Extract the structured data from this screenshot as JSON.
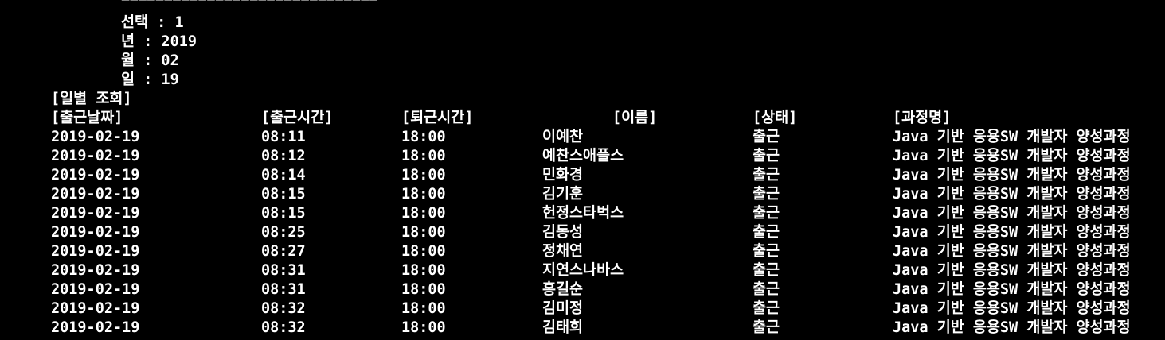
{
  "console": {
    "separator": "==============================",
    "prompts": {
      "select": "선택 : 1",
      "year": "년 : 2019",
      "month": "월 : 02",
      "day": "일 : 19"
    },
    "section_title": "[일별 조회]",
    "headers": {
      "date": "[출근날짜]",
      "check_in": "[출근시간]",
      "check_out": "[퇴근시간]",
      "name": "[이름]",
      "status": "[상태]",
      "course": "[과정명]"
    },
    "rows": [
      {
        "date": "2019-02-19",
        "check_in": "08:11",
        "check_out": "18:00",
        "name": "이예찬",
        "status": "출근",
        "course": "Java 기반 응용SW 개발자 양성과정"
      },
      {
        "date": "2019-02-19",
        "check_in": "08:12",
        "check_out": "18:00",
        "name": "예찬스애플스",
        "status": "출근",
        "course": "Java 기반 응용SW 개발자 양성과정"
      },
      {
        "date": "2019-02-19",
        "check_in": "08:14",
        "check_out": "18:00",
        "name": "민화경",
        "status": "출근",
        "course": "Java 기반 응용SW 개발자 양성과정"
      },
      {
        "date": "2019-02-19",
        "check_in": "08:15",
        "check_out": "18:00",
        "name": "김기훈",
        "status": "출근",
        "course": "Java 기반 응용SW 개발자 양성과정"
      },
      {
        "date": "2019-02-19",
        "check_in": "08:15",
        "check_out": "18:00",
        "name": "헌정스타벅스",
        "status": "출근",
        "course": "Java 기반 응용SW 개발자 양성과정"
      },
      {
        "date": "2019-02-19",
        "check_in": "08:25",
        "check_out": "18:00",
        "name": "김동성",
        "status": "출근",
        "course": "Java 기반 응용SW 개발자 양성과정"
      },
      {
        "date": "2019-02-19",
        "check_in": "08:27",
        "check_out": "18:00",
        "name": "정채연",
        "status": "출근",
        "course": "Java 기반 응용SW 개발자 양성과정"
      },
      {
        "date": "2019-02-19",
        "check_in": "08:31",
        "check_out": "18:00",
        "name": "지연스나바스",
        "status": "출근",
        "course": "Java 기반 응용SW 개발자 양성과정"
      },
      {
        "date": "2019-02-19",
        "check_in": "08:31",
        "check_out": "18:00",
        "name": "홍길순",
        "status": "출근",
        "course": "Java 기반 응용SW 개발자 양성과정"
      },
      {
        "date": "2019-02-19",
        "check_in": "08:32",
        "check_out": "18:00",
        "name": "김미정",
        "status": "출근",
        "course": "Java 기반 응용SW 개발자 양성과정"
      },
      {
        "date": "2019-02-19",
        "check_in": "08:32",
        "check_out": "18:00",
        "name": "김태희",
        "status": "출근",
        "course": "Java 기반 응용SW 개발자 양성과정"
      }
    ]
  },
  "colors": {
    "background": "#000000",
    "text": "#ffffff"
  }
}
